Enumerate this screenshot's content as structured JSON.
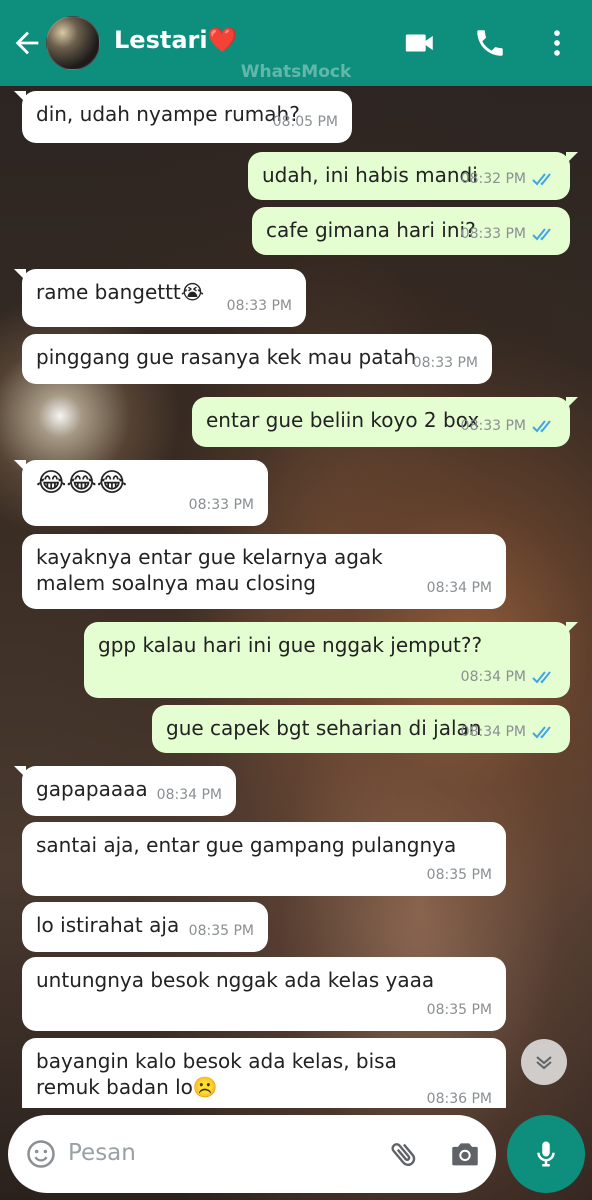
{
  "header": {
    "contact_name": "Lestari❤️",
    "watermark": "WhatsMock",
    "icons": [
      "back-arrow-icon",
      "video-call-icon",
      "voice-call-icon",
      "more-options-icon"
    ],
    "color": "#0e8f7d"
  },
  "messages": [
    {
      "dir": "in",
      "text": "din, udah nyampe rumah?",
      "time": "08:05 PM"
    },
    {
      "dir": "out",
      "text": "udah, ini habis mandi",
      "time": "08:32 PM",
      "read": true
    },
    {
      "dir": "out",
      "text": "cafe gimana hari ini?",
      "time": "08:33 PM",
      "read": true
    },
    {
      "dir": "in",
      "text": "rame bangettt😭",
      "time": "08:33 PM"
    },
    {
      "dir": "in",
      "text": "pinggang gue rasanya kek mau patah",
      "time": "08:33 PM"
    },
    {
      "dir": "out",
      "text": "entar gue beliin koyo 2 box",
      "time": "08:33 PM",
      "read": true
    },
    {
      "dir": "in",
      "text": "😂😂😂",
      "time": "08:33 PM"
    },
    {
      "dir": "in",
      "text": "kayaknya entar gue kelarnya agak malem soalnya mau closing",
      "time": "08:34 PM"
    },
    {
      "dir": "out",
      "text": "gpp kalau hari ini gue nggak jemput??",
      "time": "08:34 PM",
      "read": true
    },
    {
      "dir": "out",
      "text": "gue capek bgt seharian di jalan",
      "time": "08:34 PM",
      "read": true
    },
    {
      "dir": "in",
      "text": "gapapaaaa",
      "time": "08:34 PM"
    },
    {
      "dir": "in",
      "text": "santai aja, entar gue gampang pulangnya",
      "time": "08:35 PM"
    },
    {
      "dir": "in",
      "text": "lo istirahat aja",
      "time": "08:35 PM"
    },
    {
      "dir": "in",
      "text": "untungnya besok nggak ada kelas yaaa",
      "time": "08:35 PM"
    },
    {
      "dir": "in",
      "text": "bayangin kalo besok ada kelas, bisa remuk badan lo☹️",
      "time": "08:36 PM"
    }
  ],
  "composer": {
    "placeholder": "Pesan",
    "icons": [
      "emoji-icon",
      "attachment-icon",
      "camera-icon",
      "microphone-icon",
      "scroll-down-icon"
    ]
  },
  "colors": {
    "incoming_bubble": "#ffffff",
    "outgoing_bubble": "#e4fed2",
    "read_ticks": "#3ea6e6"
  }
}
